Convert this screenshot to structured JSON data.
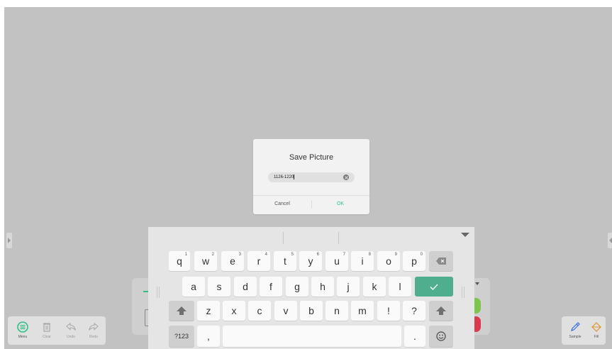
{
  "dialog": {
    "title": "Save Picture",
    "filename": "1126-1220",
    "cancel_label": "Cancel",
    "ok_label": "OK"
  },
  "toolbar_left": {
    "menu": "Menu",
    "clear": "Clear",
    "undo": "Undo",
    "redo": "Redo"
  },
  "toolbar_right": {
    "sample": "Sample",
    "fill": "Fill"
  },
  "keyboard": {
    "row1": [
      {
        "key": "q",
        "num": "1"
      },
      {
        "key": "w",
        "num": "2"
      },
      {
        "key": "e",
        "num": "3"
      },
      {
        "key": "r",
        "num": "4"
      },
      {
        "key": "t",
        "num": "5"
      },
      {
        "key": "y",
        "num": "6"
      },
      {
        "key": "u",
        "num": "7"
      },
      {
        "key": "i",
        "num": "8"
      },
      {
        "key": "o",
        "num": "9"
      },
      {
        "key": "p",
        "num": "0"
      }
    ],
    "row2": [
      "a",
      "s",
      "d",
      "f",
      "g",
      "h",
      "j",
      "k",
      "l"
    ],
    "row3": [
      "z",
      "x",
      "c",
      "v",
      "b",
      "n",
      "m",
      "!",
      "?"
    ],
    "symbols_label": "?123",
    "comma": ",",
    "period": "."
  },
  "colors": {
    "accent": "#2fbf83",
    "enter_key": "#4fae8e",
    "canvas": "#c2c2c2"
  }
}
